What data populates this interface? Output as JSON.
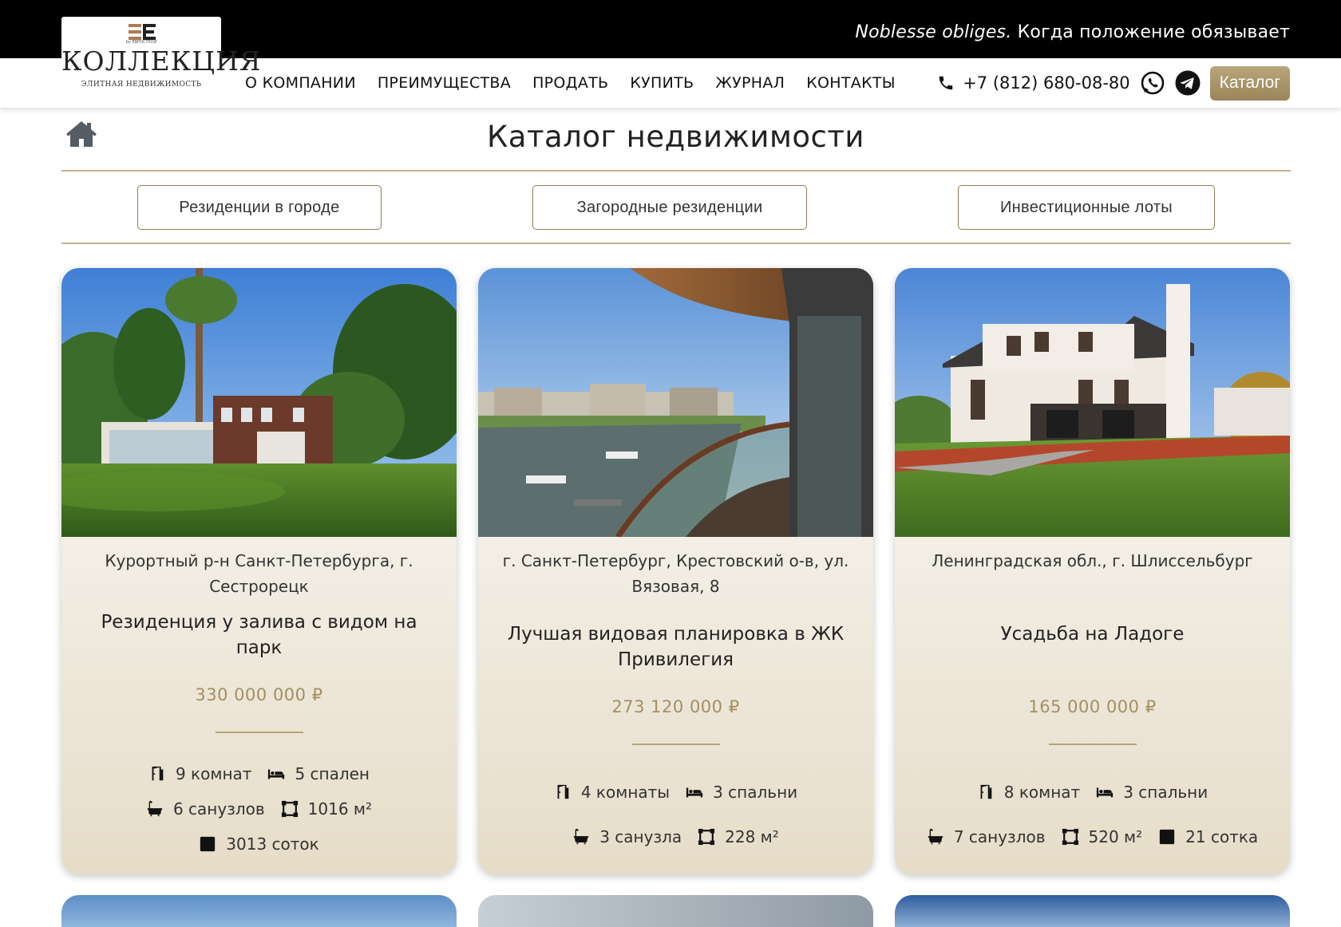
{
  "topbar": {
    "tagline_italic": "Noblesse obliges.",
    "tagline_rest": " Когда положение обязывает"
  },
  "logo": {
    "by": "by ЕВРОСТРОЙ",
    "name": "КОЛЛЕКЦИЯ",
    "subtitle": "ЭЛИТНАЯ НЕДВИЖИМОСТЬ"
  },
  "nav": {
    "items": [
      "О КОМПАНИИ",
      "ПРЕИМУЩЕСТВА",
      "ПРОДАТЬ",
      "КУПИТЬ",
      "ЖУРНАЛ",
      "КОНТАКТЫ"
    ]
  },
  "contacts": {
    "phone": "+7 (812) 680-08-80",
    "catalog_label": "Каталог"
  },
  "page": {
    "title": "Каталог недвижимости"
  },
  "filters": [
    "Резиденции в городе",
    "Загородные резиденции",
    "Инвестиционные лоты"
  ],
  "cards": [
    {
      "location": "Курортный р-н Санкт-Петербурга, г. Сестрорецк",
      "title": "Резиденция у залива с видом на парк",
      "price": "330 000 000 ₽",
      "rooms": "9 комнат",
      "bedrooms": "5 спален",
      "bathrooms": "6 санузлов",
      "area": "1016 м²",
      "plot": "3013 соток"
    },
    {
      "location": "г. Санкт-Петербург, Крестовский о-в, ул. Вязовая, 8",
      "title": "Лучшая видовая планировка в ЖК Привилегия",
      "price": "273 120 000 ₽",
      "rooms": "4 комнаты",
      "bedrooms": "3 спальни",
      "bathrooms": "3 санузла",
      "area": "228 м²"
    },
    {
      "location": "Ленинградская обл., г. Шлиссельбург",
      "title": "Усадьба на Ладоге",
      "price": "165 000 000 ₽",
      "rooms": "8 комнат",
      "bedrooms": "3 спальни",
      "bathrooms": "7 санузлов",
      "area": "520 м²",
      "plot": "21 сотка"
    }
  ]
}
